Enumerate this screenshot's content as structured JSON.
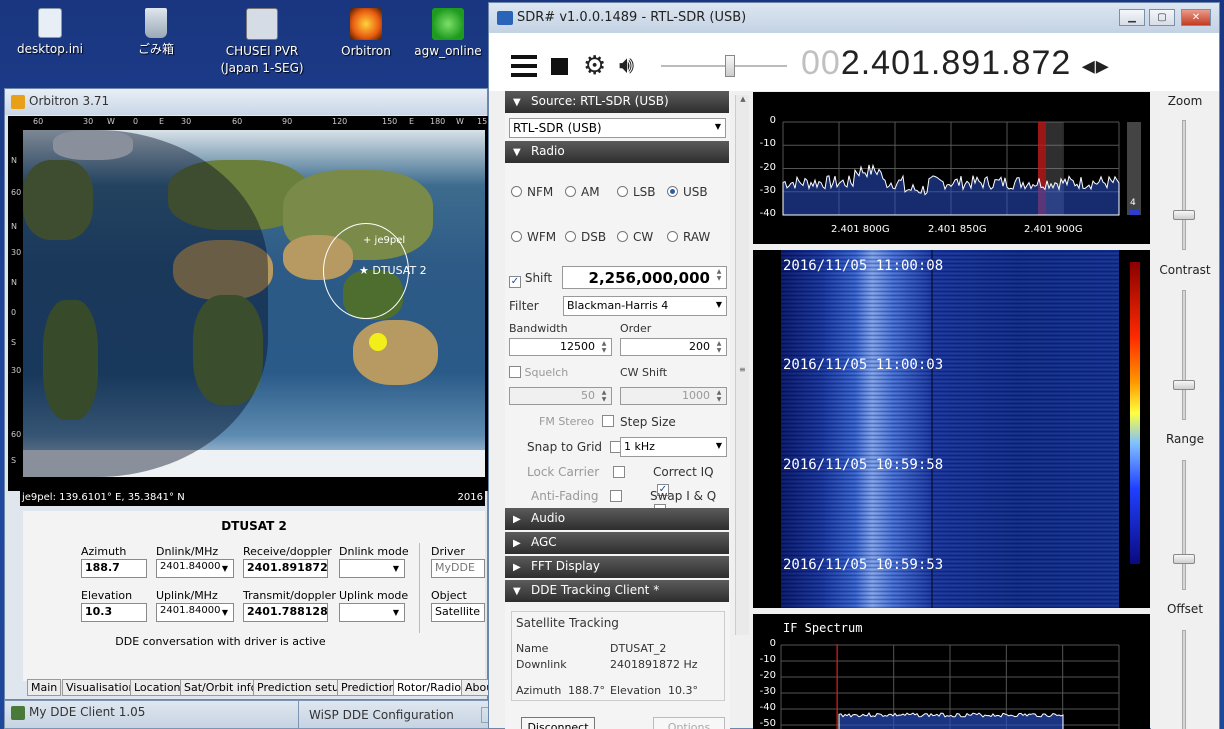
{
  "desktop": {
    "icons": [
      {
        "label": "desktop.ini"
      },
      {
        "label": "ごみ箱"
      },
      {
        "label": "CHUSEI PVR\n(Japan 1-SEG)"
      },
      {
        "label": "Orbitron"
      },
      {
        "label": "agw_online"
      }
    ]
  },
  "orbitron": {
    "title": "Orbitron 3.71",
    "map": {
      "top_ticks": [
        "60",
        "30",
        "W",
        "0",
        "E",
        "30",
        "60",
        "90",
        "120",
        "150",
        "E",
        "180",
        "W",
        "15"
      ],
      "left_ticks": [
        "N",
        "60",
        "N",
        "30",
        "N",
        "0",
        "S",
        "30",
        "60",
        "S"
      ],
      "marker_station": "+ je9pel",
      "marker_sat": "★ DTUSAT 2",
      "status_left": "je9pel: 139.6101° E, 35.3841° N",
      "status_right": "2016"
    },
    "sat_name": "DTUSAT 2",
    "fields": {
      "azimuth_label": "Azimuth",
      "azimuth": "188.7",
      "elevation_label": "Elevation",
      "elevation": "10.3",
      "dnlink_label": "Dnlink/MHz",
      "dnlink": "2401.84000",
      "uplink_label": "Uplink/MHz",
      "uplink": "2401.84000",
      "receive_label": "Receive/doppler",
      "receive": "2401.891872",
      "transmit_label": "Transmit/doppler",
      "transmit": "2401.788128",
      "dnmode_label": "Dnlink mode",
      "dnmode": "",
      "upmode_label": "Uplink mode",
      "upmode": "",
      "driver_label": "Driver",
      "driver": "MyDDE",
      "object_label": "Object",
      "object": "Satellite"
    },
    "status": "DDE conversation with driver is active",
    "tabs": [
      "Main",
      "Visualisation",
      "Location",
      "Sat/Orbit info",
      "Prediction setup",
      "Prediction",
      "Rotor/Radio",
      "Abou"
    ]
  },
  "dde_client": {
    "title": "My DDE Client 1.05"
  },
  "wisp": {
    "title": "WiSP DDE Configuration"
  },
  "sdr": {
    "title": "SDR# v1.0.0.1489 - RTL-SDR (USB)",
    "freq_lead": "00",
    "freq_main": "2.401.891.872",
    "freq_arrows": "◂▸",
    "source_header": "Source: RTL-SDR (USB)",
    "source_select": "RTL-SDR (USB)",
    "radio_header": "Radio",
    "modes": [
      {
        "label": "NFM",
        "on": false
      },
      {
        "label": "AM",
        "on": false
      },
      {
        "label": "LSB",
        "on": false
      },
      {
        "label": "USB",
        "on": true
      },
      {
        "label": "WFM",
        "on": false
      },
      {
        "label": "DSB",
        "on": false
      },
      {
        "label": "CW",
        "on": false
      },
      {
        "label": "RAW",
        "on": false
      }
    ],
    "shift_label": "Shift",
    "shift_checked": "✓",
    "shift_value": "2,256,000,000",
    "filter_label": "Filter",
    "filter_value": "Blackman-Harris 4",
    "bandwidth_label": "Bandwidth",
    "bandwidth": "12500",
    "order_label": "Order",
    "order": "200",
    "squelch_label": "Squelch",
    "squelch": "50",
    "cwshift_label": "CW Shift",
    "cwshift": "1000",
    "fmstereo_label": "FM Stereo",
    "stepsize_label": "Step Size",
    "snap_label": "Snap to Grid",
    "snap_value": "1 kHz",
    "lockcarrier_label": "Lock Carrier",
    "correctiq_label": "Correct IQ",
    "correctiq_checked": "✓",
    "antifading_label": "Anti-Fading",
    "swapiq_label": "Swap I & Q",
    "audio_header": "Audio",
    "agc_header": "AGC",
    "fft_header": "FFT Display",
    "dde_header": "DDE Tracking Client *",
    "tracking": {
      "group": "Satellite Tracking",
      "name_label": "Name",
      "name": "DTUSAT_2",
      "downlink_label": "Downlink",
      "downlink": "2401891872 Hz",
      "azimuth_label": "Azimuth",
      "azimuth": "188.7°",
      "elevation_label": "Elevation",
      "elevation": "10.3°"
    },
    "disconnect": "Disconnect",
    "options": "Options",
    "spectrum": {
      "yticks": [
        "0",
        "-10",
        "-20",
        "-30",
        "-40"
      ],
      "xticks": [
        "2.401 800G",
        "2.401 850G",
        "2.401 900G"
      ],
      "meter": "4"
    },
    "waterfall_times": [
      "2016/11/05 11:00:08",
      "2016/11/05 11:00:03",
      "2016/11/05 10:59:58",
      "2016/11/05 10:59:53"
    ],
    "if_spectrum": {
      "title": "IF Spectrum",
      "yticks": [
        "0",
        "-10",
        "-20",
        "-30",
        "-40",
        "-50"
      ]
    },
    "sliders": {
      "zoom": "Zoom",
      "contrast": "Contrast",
      "range": "Range",
      "offset": "Offset"
    }
  }
}
